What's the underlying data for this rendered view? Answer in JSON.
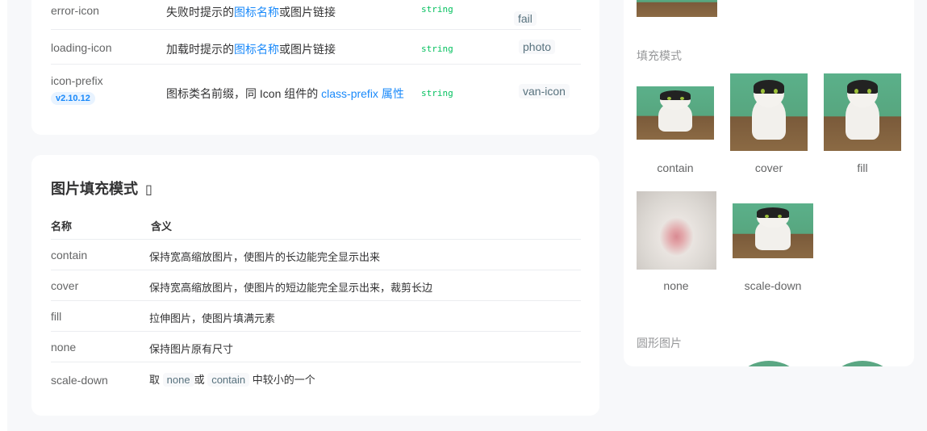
{
  "api_table": {
    "rows": [
      {
        "name": "error-icon",
        "desc_pre": "失败时提示的",
        "desc_link": "图标名称",
        "desc_post": "或图片链接",
        "type": "string",
        "default": "fail"
      },
      {
        "name": "loading-icon",
        "desc_pre": "加载时提示的",
        "desc_link": "图标名称",
        "desc_post": "或图片链接",
        "type": "string",
        "default": "photo"
      },
      {
        "name": "icon-prefix",
        "badge": "v2.10.12",
        "desc_pre": "图标类名前缀，同 Icon 组件的 ",
        "desc_link": "class-prefix 属性",
        "desc_post": "",
        "type": "string",
        "default": "van-icon"
      }
    ]
  },
  "fit_section": {
    "title": "图片填充模式",
    "anchor": "▯",
    "headers": {
      "name": "名称",
      "desc": "含义"
    },
    "rows": [
      {
        "name": "contain",
        "desc": "保持宽高缩放图片，使图片的长边能完全显示出来"
      },
      {
        "name": "cover",
        "desc": "保持宽高缩放图片，使图片的短边能完全显示出来，裁剪长边"
      },
      {
        "name": "fill",
        "desc": "拉伸图片，使图片填满元素"
      },
      {
        "name": "none",
        "desc": "保持图片原有尺寸"
      },
      {
        "name": "scale-down",
        "desc_pre": "取",
        "code1": "none",
        "desc_mid": "或",
        "code2": "contain",
        "desc_post": "中较小的一个"
      }
    ]
  },
  "preview": {
    "fill_mode_title": "填充模式",
    "fit_labels": [
      "contain",
      "cover",
      "fill",
      "none",
      "scale-down"
    ],
    "round_title": "圆形图片"
  },
  "colors": {
    "link": "#1989fa",
    "type_green": "#07c160",
    "badge_bg": "#e8f3ff",
    "cat_bg_green": "#5bb08a"
  }
}
